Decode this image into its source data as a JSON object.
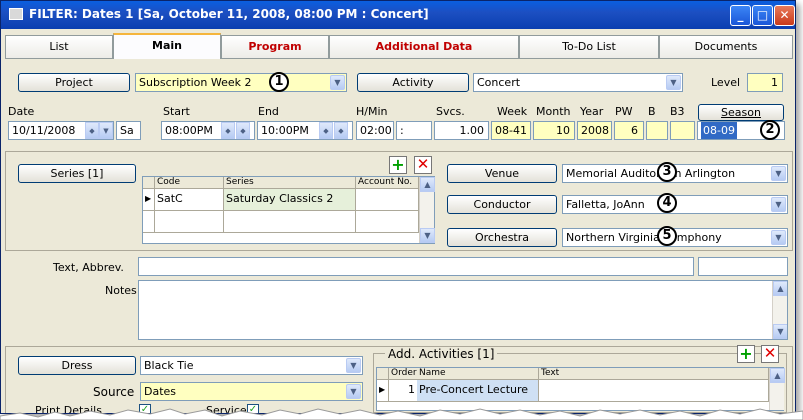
{
  "window": {
    "title": "FILTER: Dates  1 [Sa, October  11, 2008, 08:00 PM :  Concert]"
  },
  "tabs": [
    {
      "label": "List"
    },
    {
      "label": "Main"
    },
    {
      "label": "Program"
    },
    {
      "label": "Additional Data"
    },
    {
      "label": "To-Do List"
    },
    {
      "label": "Documents"
    }
  ],
  "row1": {
    "project_button": "Project",
    "project_value": "Subscription Week  2",
    "activity_button": "Activity",
    "activity_value": "Concert",
    "level_label": "Level",
    "level_value": "1"
  },
  "row2": {
    "date_label": "Date",
    "start_label": "Start",
    "end_label": "End",
    "hmin_label": "H/Min",
    "svcs_label": "Svcs.",
    "week_label": "Week",
    "month_label": "Month",
    "year_label": "Year",
    "pw_label": "PW",
    "b_label": "B",
    "b3_label": "B3",
    "season_button": "Season",
    "date_value": "10/11/2008",
    "day_value": "Sa",
    "start_value": "08:00PM",
    "end_value": "10:00PM",
    "hmin_value": "02:00",
    "colon": ":",
    "svcs_value": "1.00",
    "week_value": "08-41",
    "month_value": "10",
    "year_value": "2008",
    "pw_value": "6",
    "season_value": "08-09"
  },
  "series": {
    "button": "Series  [1]",
    "headers": [
      "Code",
      "Series",
      "Account No."
    ],
    "rows": [
      {
        "code": "SatC",
        "series": "Saturday Classics 2",
        "account": ""
      }
    ]
  },
  "venue": {
    "button": "Venue",
    "value": "Memorial Auditorium Arlington"
  },
  "conductor": {
    "button": "Conductor",
    "value": "Falletta, JoAnn"
  },
  "orchestra": {
    "button": "Orchestra",
    "value": "Northern Virginia Symphony"
  },
  "text_abbrev": {
    "label": "Text, Abbrev."
  },
  "notes": {
    "label": "Notes"
  },
  "dress": {
    "button": "Dress",
    "value": "Black Tie"
  },
  "source": {
    "label": "Source",
    "value": "Dates"
  },
  "print_details": {
    "label": "Print Details"
  },
  "service": {
    "label": "Service"
  },
  "add_activities": {
    "title": "Add. Activities  [1]",
    "headers": [
      "Order",
      "Name",
      "Text"
    ],
    "rows": [
      {
        "order": "1",
        "name": "Pre-Concert Lecture",
        "text": ""
      }
    ]
  },
  "callouts": [
    "1",
    "2",
    "3",
    "4",
    "5"
  ],
  "colors": {
    "title_bar": "#0b3fb0",
    "highlight": "#ffffc0",
    "selection": "#316ac5",
    "accent_tab": "#f5b53c"
  }
}
